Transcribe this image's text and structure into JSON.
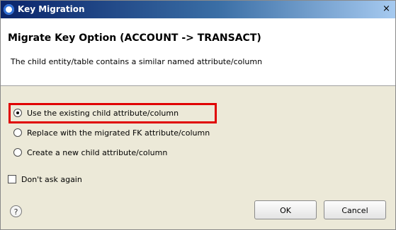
{
  "window": {
    "title": "Key Migration",
    "close_label": "×"
  },
  "header": {
    "title": "Migrate Key Option (ACCOUNT -> TRANSACT)",
    "description": "The child entity/table contains a similar named attribute/column"
  },
  "options": [
    {
      "label": "Use the existing child attribute/column",
      "checked": true
    },
    {
      "label": "Replace with the migrated FK attribute/column",
      "checked": false
    },
    {
      "label": "Create a new child attribute/column",
      "checked": false
    }
  ],
  "dont_ask": {
    "label": "Don't ask again",
    "checked": false
  },
  "help": {
    "glyph": "?"
  },
  "buttons": {
    "ok": "OK",
    "cancel": "Cancel"
  },
  "colors": {
    "highlight": "#e00000",
    "titlebar": "#0a246a"
  }
}
